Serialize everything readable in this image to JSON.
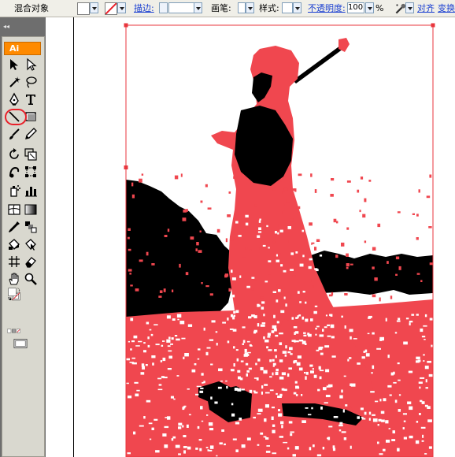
{
  "control_bar": {
    "selection_label": "混合对象",
    "stroke_label": "描边:",
    "brush_label": "画笔:",
    "style_label": "样式:",
    "opacity_label": "不透明度:",
    "opacity_value": "100",
    "percent_sign": "%",
    "align_label": "对齐",
    "transform_label": "变换"
  },
  "tools_panel": {
    "collapse_glyph": "◂◂",
    "logo_text": "Ai",
    "highlighted_tool": "magic-wand-tool",
    "tools": [
      "selection-tool",
      "direct-selection-tool",
      "magic-wand-tool",
      "lasso-tool",
      "pen-tool",
      "type-tool",
      "line-segment-tool",
      "rectangle-tool",
      "paintbrush-tool",
      "pencil-tool",
      "rotate-tool",
      "scale-tool",
      "warp-tool",
      "free-transform-tool",
      "symbol-sprayer-tool",
      "column-graph-tool",
      "mesh-tool",
      "gradient-tool",
      "eyedropper-tool",
      "blend-tool",
      "live-paint-bucket-tool",
      "live-paint-selection-tool",
      "slice-tool",
      "eraser-tool",
      "hand-tool",
      "zoom-tool"
    ]
  },
  "colors": {
    "artwork_fill": "#f0474f",
    "selection_bbox": "#e8363d",
    "highlight_ring": "#e8202a",
    "logo_bg": "#ff8a00"
  }
}
